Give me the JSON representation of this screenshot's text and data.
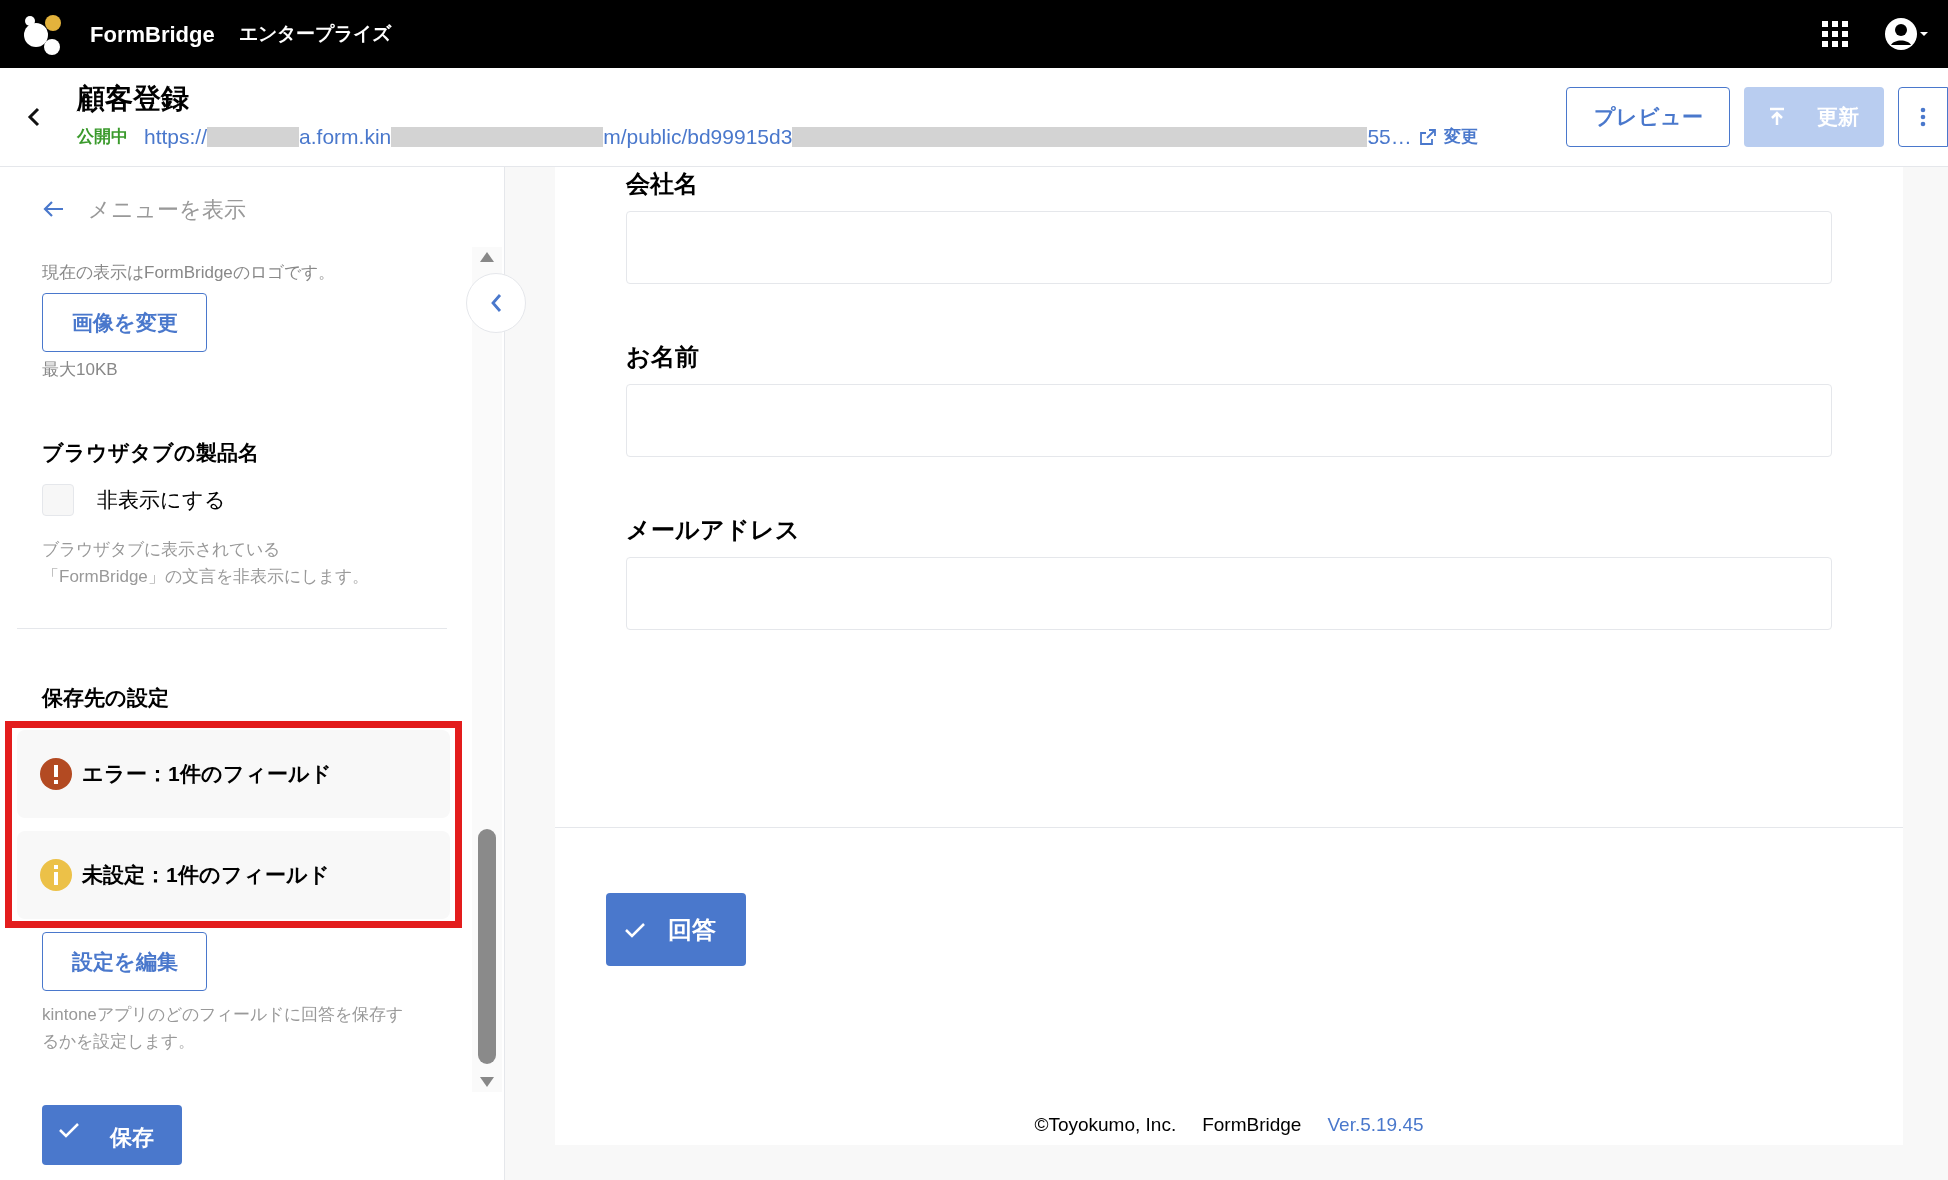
{
  "top_bar": {
    "brand": "FormBridge",
    "edition": "エンタープライズ"
  },
  "form_header": {
    "title": "顧客登録",
    "status": "公開中",
    "url_parts": [
      {
        "kind": "text",
        "text": "https://"
      },
      {
        "kind": "redacted"
      },
      {
        "kind": "text",
        "text": "a.form.kin"
      },
      {
        "kind": "redacted"
      },
      {
        "kind": "text",
        "text": "m/public/bd99915d3"
      },
      {
        "kind": "redacted"
      },
      {
        "kind": "text",
        "text": "55…"
      }
    ],
    "change_link": "変更",
    "preview_button": "プレビュー",
    "update_button": {
      "label": "更新",
      "disabled": true
    }
  },
  "sidebar": {
    "menu_link": "メニューを表示",
    "logo_note": "現在の表示はFormBridgeのロゴです。",
    "change_image_button": "画像を変更",
    "size_note": "最大10KB",
    "tab_name_heading": "ブラウザタブの製品名",
    "hide_checkbox": {
      "label": "非表示にする",
      "checked": false
    },
    "tab_name_note_lines": [
      "ブラウザタブに表示されている",
      "「FormBridge」の文言を非表示にします。"
    ],
    "save_heading": "保存先の設定",
    "alerts": [
      {
        "kind": "error",
        "text": "エラー：1件のフィールド"
      },
      {
        "kind": "warning",
        "text": "未設定：1件のフィールド"
      }
    ],
    "edit_button": "設定を編集",
    "save_note": "kintoneアプリのどのフィールドに回答を保存するかを設定します。",
    "save_button": "保存"
  },
  "form": {
    "fields": [
      {
        "label": "会社名"
      },
      {
        "label": "お名前"
      },
      {
        "label": "メールアドレス"
      }
    ],
    "submit_button": "回答"
  },
  "footer": {
    "copyright": "©Toyokumo, Inc.",
    "product": "FormBridge",
    "version": "Ver.5.19.45"
  }
}
